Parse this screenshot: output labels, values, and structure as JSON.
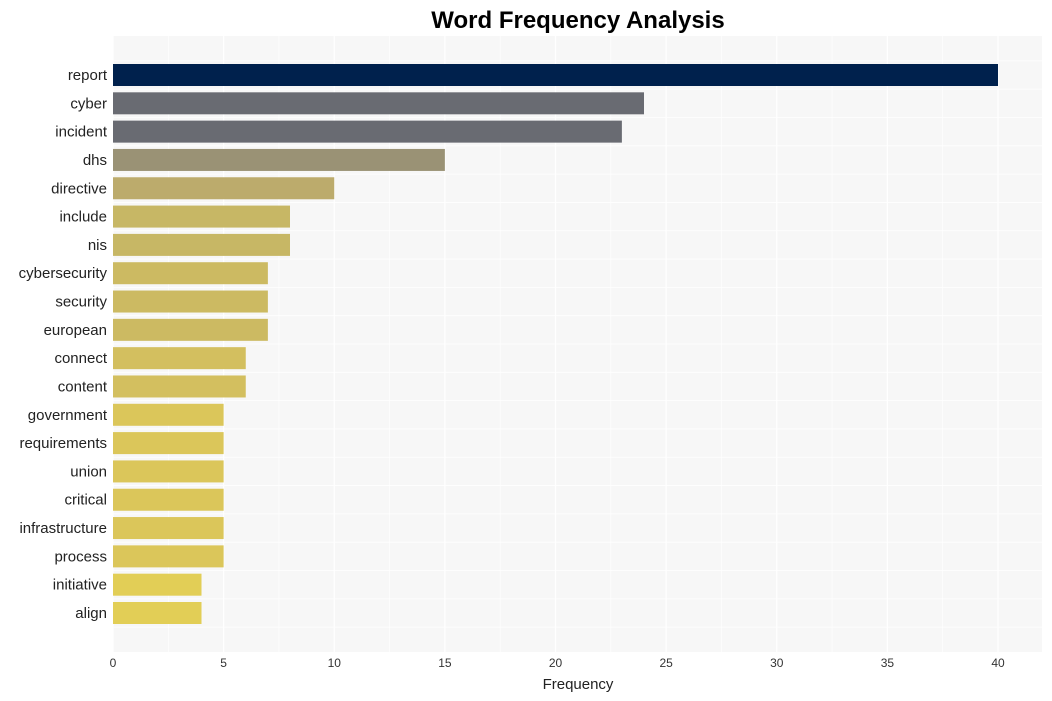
{
  "chart_data": {
    "type": "bar",
    "orientation": "horizontal",
    "title": "Word Frequency Analysis",
    "xlabel": "Frequency",
    "ylabel": "",
    "xlim": [
      0,
      42
    ],
    "xticks": [
      0,
      5,
      10,
      15,
      20,
      25,
      30,
      35,
      40
    ],
    "grid": true,
    "categories": [
      "report",
      "cyber",
      "incident",
      "dhs",
      "directive",
      "include",
      "nis",
      "cybersecurity",
      "security",
      "european",
      "connect",
      "content",
      "government",
      "requirements",
      "union",
      "critical",
      "infrastructure",
      "process",
      "initiative",
      "align"
    ],
    "values": [
      40,
      24,
      23,
      15,
      10,
      8,
      8,
      7,
      7,
      7,
      6,
      6,
      5,
      5,
      5,
      5,
      5,
      5,
      4,
      4
    ],
    "colors": [
      "#00214d",
      "#696b72",
      "#696b72",
      "#9a9275",
      "#bcab6c",
      "#c7b765",
      "#c7b765",
      "#ccba62",
      "#ccba62",
      "#ccba62",
      "#d3bf5f",
      "#d3bf5f",
      "#dbc65a",
      "#dbc65a",
      "#dbc65a",
      "#dbc65a",
      "#dbc65a",
      "#dbc65a",
      "#e2ce56",
      "#e2ce56"
    ],
    "background": "#f7f7f7",
    "gridline_color": "#ffffff"
  }
}
